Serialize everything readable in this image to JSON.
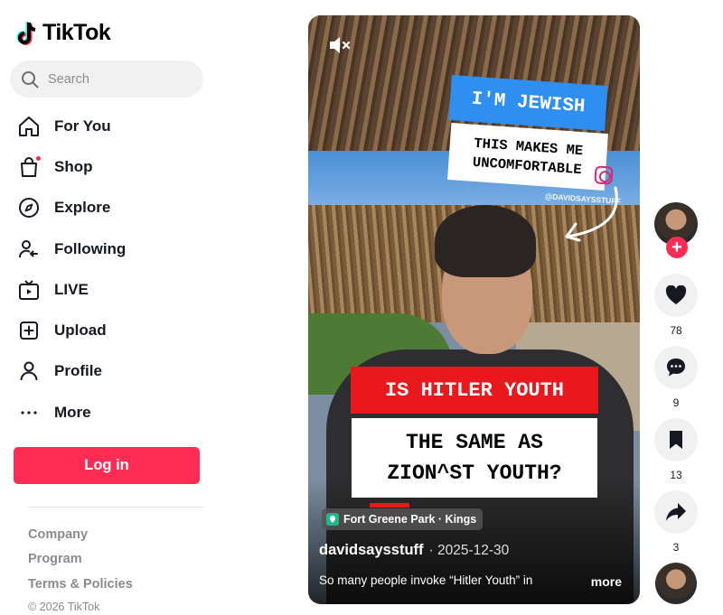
{
  "brand": {
    "name": "TikTok"
  },
  "search": {
    "placeholder": "Search"
  },
  "nav": {
    "items": [
      {
        "label": "For You",
        "icon": "home-icon"
      },
      {
        "label": "Shop",
        "icon": "shopping-bag-icon"
      },
      {
        "label": "Explore",
        "icon": "compass-icon"
      },
      {
        "label": "Following",
        "icon": "following-icon"
      },
      {
        "label": "LIVE",
        "icon": "live-tv-icon"
      },
      {
        "label": "Upload",
        "icon": "upload-plus-icon"
      },
      {
        "label": "Profile",
        "icon": "profile-icon"
      },
      {
        "label": "More",
        "icon": "more-dots-icon"
      }
    ]
  },
  "login": {
    "label": "Log in"
  },
  "footer": {
    "links": [
      "Company",
      "Program",
      "Terms & Policies"
    ],
    "copyright": "© 2026 TikTok"
  },
  "video": {
    "captions": {
      "top_blue": "I'M JEWISH",
      "top_white_1": "THIS MAKES ME",
      "top_white_2": "UNCOMFORTABLE",
      "handle_tag": "@DAVIDSAYSSTUFF",
      "red": "IS HITLER YOUTH",
      "question_1": "THE SAME AS",
      "question_2": "ZION^ST YOUTH?"
    },
    "location": "Fort Greene Park · Kings",
    "author": "davidsaysstuff",
    "date": "· 2025-12-30",
    "description": "So many people invoke “Hitler Youth” in",
    "more_label": "more"
  },
  "actions": {
    "likes": "78",
    "comments": "9",
    "saves": "13",
    "shares": "3"
  },
  "colors": {
    "accent": "#fe2c55",
    "caption_blue": "#2f8ff1",
    "caption_red": "#e8181c"
  }
}
